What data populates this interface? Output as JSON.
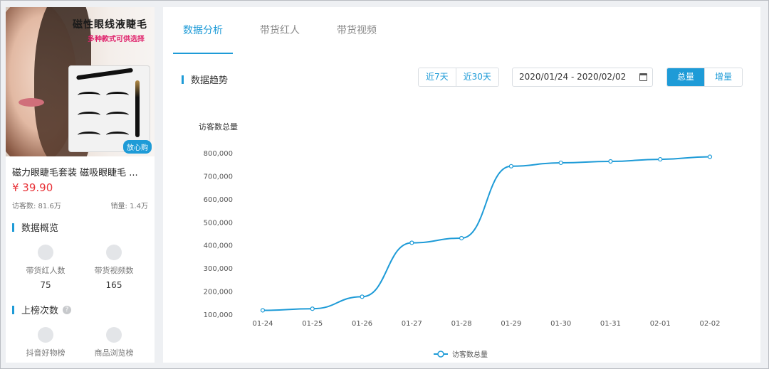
{
  "product": {
    "promo_title": "磁性眼线液睫毛",
    "promo_subtitle": "多种款式可供选择",
    "badge": "放心购",
    "name": "磁力眼睫毛套装 磁吸眼睫毛 ...",
    "price": "¥ 39.90",
    "visitors": "访客数: 81.6万",
    "sales": "销量: 1.4万"
  },
  "overview": {
    "title": "数据概览",
    "influencer_label": "带货红人数",
    "influencer_value": "75",
    "video_label": "带货视频数",
    "video_value": "165"
  },
  "ranking": {
    "title": "上榜次数",
    "help": "?",
    "douyin_label": "抖音好物榜",
    "browse_label": "商品浏览榜"
  },
  "tabs": [
    "数据分析",
    "带货红人",
    "带货视频"
  ],
  "trend": {
    "title": "数据趋势",
    "btn_7": "近7天",
    "btn_30": "近30天",
    "date_range": "2020/01/24 - 2020/02/02",
    "btn_total": "总量",
    "btn_increment": "增量"
  },
  "colors": {
    "accent": "#1e9bd7",
    "price": "#e8343a"
  },
  "chart_data": {
    "type": "line",
    "ylabel": "访客数总量",
    "x": [
      "01-24",
      "01-25",
      "01-26",
      "01-27",
      "01-28",
      "01-29",
      "01-30",
      "01-31",
      "02-01",
      "02-02"
    ],
    "series": [
      {
        "name": "访客数总量",
        "values": [
          117000,
          124000,
          176000,
          410000,
          430000,
          742000,
          757000,
          763000,
          772000,
          783000
        ]
      }
    ],
    "ylim": [
      100000,
      800000
    ],
    "yticks": [
      "100,000",
      "200,000",
      "300,000",
      "400,000",
      "500,000",
      "600,000",
      "700,000",
      "800,000"
    ],
    "legend": "bottom",
    "grid": false
  }
}
